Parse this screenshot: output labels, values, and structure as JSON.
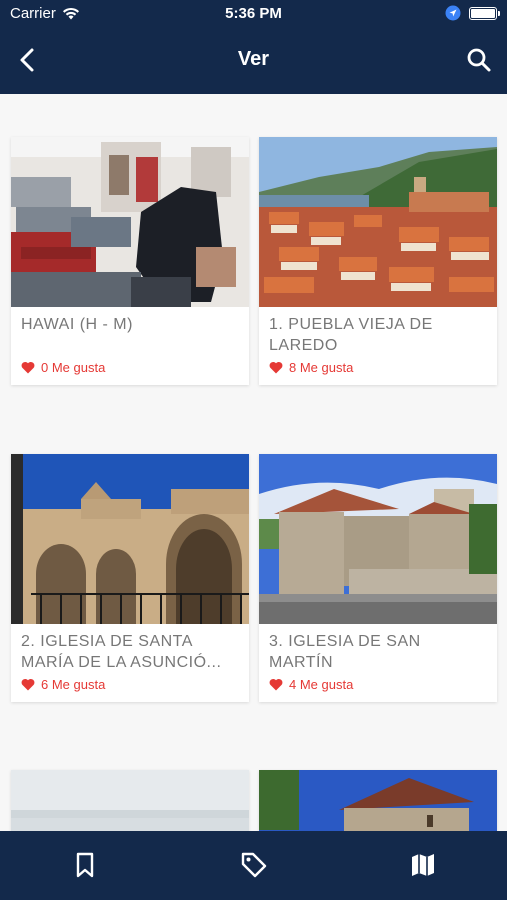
{
  "status": {
    "carrier": "Carrier",
    "time": "5:36 PM"
  },
  "nav": {
    "title": "Ver",
    "back_icon": "chevron-left-icon",
    "search_icon": "search-icon"
  },
  "cards": [
    {
      "title": "HAWAI (H - M)",
      "likes": "0 Me gusta",
      "image": "clothing-store-photo"
    },
    {
      "title": "1. PUEBLA VIEJA DE\nLAREDO",
      "likes": "8 Me gusta",
      "image": "town-rooftops-photo"
    },
    {
      "title": "2. IGLESIA DE SANTA\nMARÍA DE LA ASUNCIÓ...",
      "likes": "6 Me gusta",
      "image": "church-facade-photo"
    },
    {
      "title": "3. IGLESIA DE SAN\nMARTÍN",
      "likes": "4 Me gusta",
      "image": "stone-church-photo"
    }
  ],
  "tabs": [
    {
      "name": "bookmark-icon"
    },
    {
      "name": "tag-icon"
    },
    {
      "name": "map-icon"
    }
  ],
  "colors": {
    "header": "#13294b",
    "accent": "#e53935"
  }
}
